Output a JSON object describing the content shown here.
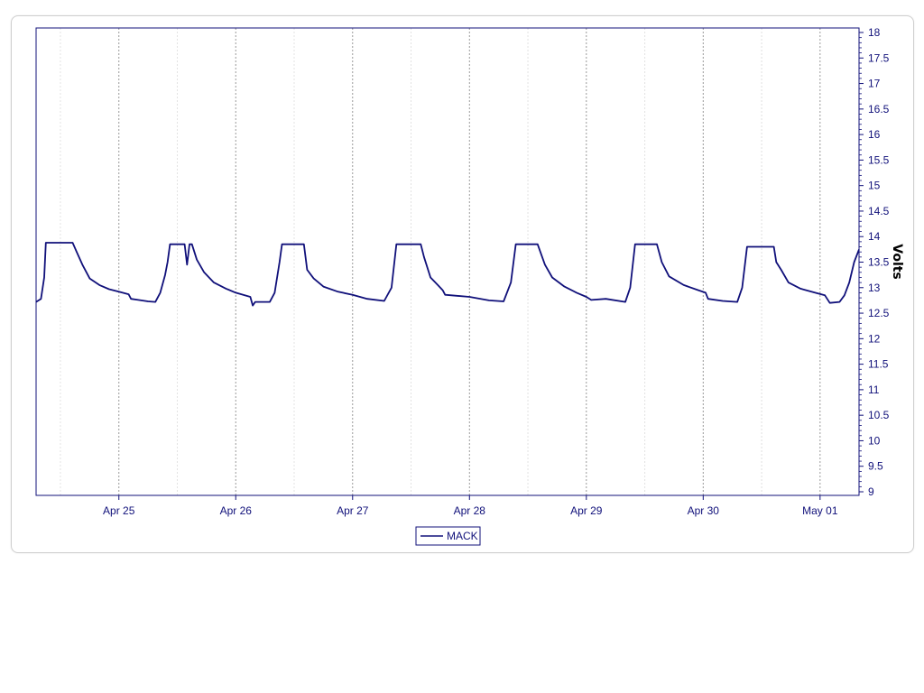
{
  "chart_data": {
    "type": "line",
    "title": "",
    "xlabel": "",
    "ylabel": "Volts",
    "ylim": [
      9,
      18
    ],
    "xlim": [
      "2024-04-24T07:00",
      "2024-05-01T08:00"
    ],
    "y_ticks": [
      "9",
      "9.5",
      "10",
      "10.5",
      "11",
      "11.5",
      "12",
      "12.5",
      "13",
      "13.5",
      "14",
      "14.5",
      "15",
      "15.5",
      "16",
      "16.5",
      "17",
      "17.5",
      "18"
    ],
    "x_ticks": [
      {
        "label": "Apr 25",
        "date": "2024-04-25T00:00"
      },
      {
        "label": "Apr 26",
        "date": "2024-04-26T00:00"
      },
      {
        "label": "Apr 27",
        "date": "2024-04-27T00:00"
      },
      {
        "label": "Apr 28",
        "date": "2024-04-28T00:00"
      },
      {
        "label": "Apr 29",
        "date": "2024-04-29T00:00"
      },
      {
        "label": "Apr 30",
        "date": "2024-04-30T00:00"
      },
      {
        "label": "May 01",
        "date": "2024-05-01T00:00"
      }
    ],
    "grid": {
      "vertical_major": true,
      "vertical_minor": true,
      "horizontal": false
    },
    "legend_position": "bottom-center",
    "series": [
      {
        "name": "MACK",
        "color": "#10107a",
        "points": [
          [
            "2024-04-24T07:00",
            12.72
          ],
          [
            "2024-04-24T08:00",
            12.78
          ],
          [
            "2024-04-24T08:40",
            13.2
          ],
          [
            "2024-04-24T09:00",
            13.88
          ],
          [
            "2024-04-24T14:30",
            13.88
          ],
          [
            "2024-04-24T15:20",
            13.7
          ],
          [
            "2024-04-24T16:30",
            13.45
          ],
          [
            "2024-04-24T18:00",
            13.18
          ],
          [
            "2024-04-24T20:00",
            13.05
          ],
          [
            "2024-04-24T22:00",
            12.97
          ],
          [
            "2024-04-25T00:00",
            12.92
          ],
          [
            "2024-04-25T02:00",
            12.87
          ],
          [
            "2024-04-25T02:30",
            12.78
          ],
          [
            "2024-04-25T04:00",
            12.76
          ],
          [
            "2024-04-25T06:00",
            12.73
          ],
          [
            "2024-04-25T07:30",
            12.72
          ],
          [
            "2024-04-25T08:30",
            12.9
          ],
          [
            "2024-04-25T09:30",
            13.25
          ],
          [
            "2024-04-25T10:00",
            13.5
          ],
          [
            "2024-04-25T10:30",
            13.85
          ],
          [
            "2024-04-25T13:30",
            13.85
          ],
          [
            "2024-04-25T14:00",
            13.45
          ],
          [
            "2024-04-25T14:30",
            13.85
          ],
          [
            "2024-04-25T15:00",
            13.85
          ],
          [
            "2024-04-25T16:00",
            13.55
          ],
          [
            "2024-04-25T17:30",
            13.3
          ],
          [
            "2024-04-25T19:30",
            13.1
          ],
          [
            "2024-04-25T22:00",
            12.98
          ],
          [
            "2024-04-26T00:00",
            12.9
          ],
          [
            "2024-04-26T03:00",
            12.82
          ],
          [
            "2024-04-26T03:30",
            12.65
          ],
          [
            "2024-04-26T04:00",
            12.72
          ],
          [
            "2024-04-26T07:00",
            12.72
          ],
          [
            "2024-04-26T08:00",
            12.9
          ],
          [
            "2024-04-26T09:00",
            13.5
          ],
          [
            "2024-04-26T09:30",
            13.85
          ],
          [
            "2024-04-26T14:00",
            13.85
          ],
          [
            "2024-04-26T14:40",
            13.35
          ],
          [
            "2024-04-26T16:00",
            13.18
          ],
          [
            "2024-04-26T18:00",
            13.02
          ],
          [
            "2024-04-26T21:00",
            12.92
          ],
          [
            "2024-04-27T00:00",
            12.86
          ],
          [
            "2024-04-27T03:00",
            12.78
          ],
          [
            "2024-04-27T06:30",
            12.74
          ],
          [
            "2024-04-27T08:00",
            13.0
          ],
          [
            "2024-04-27T09:00",
            13.85
          ],
          [
            "2024-04-27T14:00",
            13.85
          ],
          [
            "2024-04-27T14:40",
            13.6
          ],
          [
            "2024-04-27T16:00",
            13.2
          ],
          [
            "2024-04-27T17:30",
            13.05
          ],
          [
            "2024-04-27T18:30",
            12.95
          ],
          [
            "2024-04-27T19:00",
            12.86
          ],
          [
            "2024-04-28T00:00",
            12.82
          ],
          [
            "2024-04-28T04:00",
            12.75
          ],
          [
            "2024-04-28T07:00",
            12.73
          ],
          [
            "2024-04-28T08:30",
            13.1
          ],
          [
            "2024-04-28T09:30",
            13.85
          ],
          [
            "2024-04-28T14:00",
            13.85
          ],
          [
            "2024-04-28T15:30",
            13.45
          ],
          [
            "2024-04-28T17:00",
            13.2
          ],
          [
            "2024-04-28T19:30",
            13.02
          ],
          [
            "2024-04-28T22:00",
            12.9
          ],
          [
            "2024-04-29T00:00",
            12.82
          ],
          [
            "2024-04-29T01:00",
            12.76
          ],
          [
            "2024-04-29T04:00",
            12.78
          ],
          [
            "2024-04-29T08:00",
            12.72
          ],
          [
            "2024-04-29T09:00",
            13.0
          ],
          [
            "2024-04-29T10:00",
            13.85
          ],
          [
            "2024-04-29T14:30",
            13.85
          ],
          [
            "2024-04-29T15:30",
            13.5
          ],
          [
            "2024-04-29T17:00",
            13.22
          ],
          [
            "2024-04-29T20:00",
            13.05
          ],
          [
            "2024-04-29T23:00",
            12.95
          ],
          [
            "2024-04-30T00:30",
            12.9
          ],
          [
            "2024-04-30T01:00",
            12.78
          ],
          [
            "2024-04-30T04:00",
            12.74
          ],
          [
            "2024-04-30T07:00",
            12.72
          ],
          [
            "2024-04-30T08:00",
            13.0
          ],
          [
            "2024-04-30T09:00",
            13.8
          ],
          [
            "2024-04-30T14:30",
            13.8
          ],
          [
            "2024-04-30T15:00",
            13.5
          ],
          [
            "2024-04-30T16:00",
            13.35
          ],
          [
            "2024-04-30T17:30",
            13.1
          ],
          [
            "2024-04-30T20:00",
            12.98
          ],
          [
            "2024-04-30T23:00",
            12.9
          ],
          [
            "2024-05-01T01:00",
            12.85
          ],
          [
            "2024-05-01T02:00",
            12.7
          ],
          [
            "2024-05-01T04:00",
            12.72
          ],
          [
            "2024-05-01T05:00",
            12.85
          ],
          [
            "2024-05-01T06:00",
            13.1
          ],
          [
            "2024-05-01T07:00",
            13.5
          ],
          [
            "2024-05-01T08:00",
            13.75
          ]
        ]
      }
    ]
  }
}
